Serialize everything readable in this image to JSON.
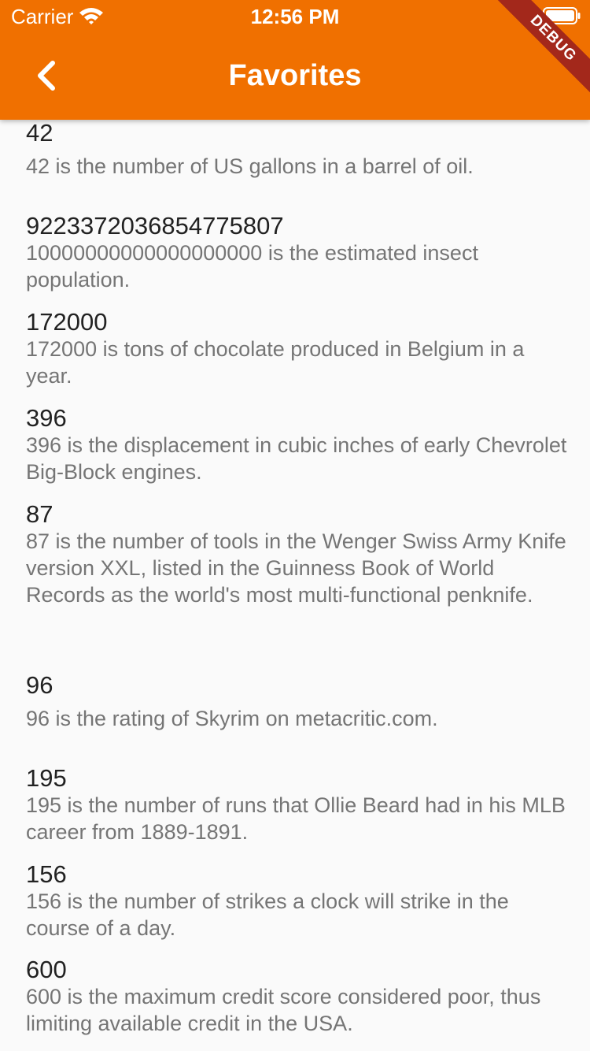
{
  "status_bar": {
    "carrier": "Carrier",
    "time": "12:56 PM"
  },
  "app_bar": {
    "title": "Favorites",
    "back_icon": "chevron-left-icon",
    "debug_banner": "DEBUG",
    "color": "#f07000"
  },
  "favorites": [
    {
      "number": "42",
      "fact": "42 is the number of US gallons in a barrel of oil."
    },
    {
      "number": "9223372036854775807",
      "fact": "10000000000000000000 is the estimated insect population."
    },
    {
      "number": "172000",
      "fact": "172000 is tons of chocolate produced in Belgium in a year."
    },
    {
      "number": "396",
      "fact": "396 is the displacement in cubic inches of early Chevrolet Big-Block engines."
    },
    {
      "number": "87",
      "fact": "87 is the number of tools in the Wenger Swiss Army Knife version XXL, listed in the Guinness Book of World Records as the world's most multi-functional penknife."
    },
    {
      "number": "96",
      "fact": "96 is the rating of Skyrim on metacritic.com."
    },
    {
      "number": "195",
      "fact": "195 is the number of runs that Ollie Beard had in his MLB career from 1889-1891."
    },
    {
      "number": "156",
      "fact": "156 is the number of strikes a clock will strike in the course of a day."
    },
    {
      "number": "600",
      "fact": "600 is the maximum credit score considered poor, thus limiting available credit in the USA."
    }
  ]
}
